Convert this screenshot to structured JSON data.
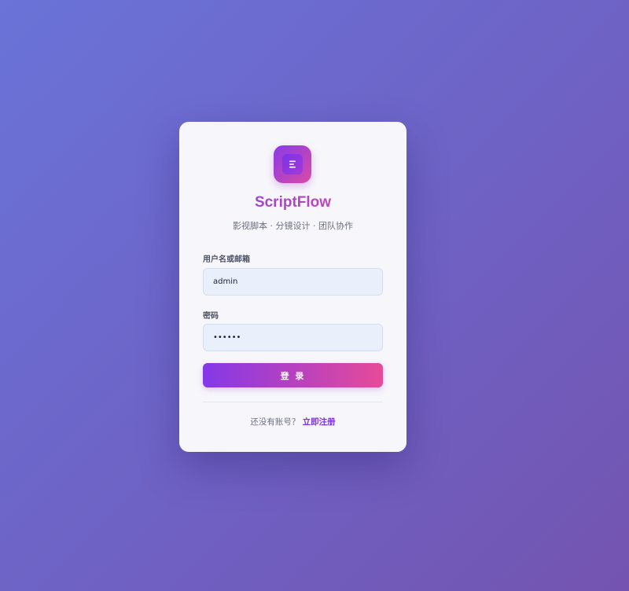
{
  "brand": {
    "name": "ScriptFlow",
    "tagline": "影视脚本 · 分镜设计 · 团队协作",
    "icon": "script-icon"
  },
  "form": {
    "username_label": "用户名或邮箱",
    "username_value": "admin",
    "password_label": "密码",
    "password_value": "••••••",
    "login_label": "登 录"
  },
  "register": {
    "prompt": "还没有账号？",
    "link_label": "立即注册"
  },
  "colors": {
    "accent_start": "#8438e8",
    "accent_end": "#e74a98",
    "background_start": "#6a73d8",
    "background_end": "#7454b0"
  }
}
